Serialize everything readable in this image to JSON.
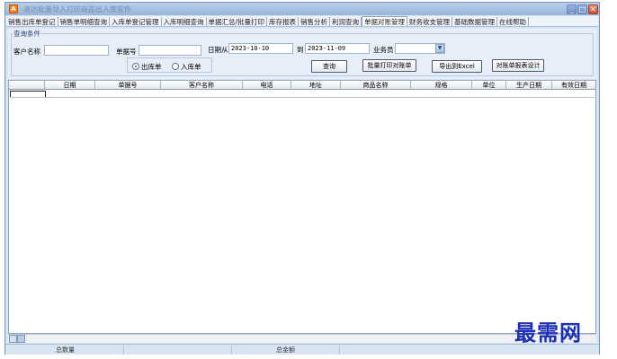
{
  "window": {
    "title": "速达批量导入打印商品出入库软件",
    "app_icon": "A"
  },
  "tabs": [
    {
      "label": "销售出库单登记",
      "active": false
    },
    {
      "label": "销售单明细查询",
      "active": false
    },
    {
      "label": "入库单登记管理",
      "active": false
    },
    {
      "label": "入库明细查询",
      "active": false
    },
    {
      "label": "单据汇总/批量打印",
      "active": false
    },
    {
      "label": "库存报表",
      "active": false
    },
    {
      "label": "销售分析",
      "active": false
    },
    {
      "label": "利润查询",
      "active": false
    },
    {
      "label": "单据对账管理",
      "active": true
    },
    {
      "label": "财务收支管理",
      "active": false
    },
    {
      "label": "基础数据管理",
      "active": false
    },
    {
      "label": "在线帮助",
      "active": false
    }
  ],
  "query": {
    "legend": "查询条件",
    "customer_label": "客户名称",
    "customer_value": "",
    "doc_no_label": "单据号",
    "doc_no_value": "",
    "date_from_label": "日期从",
    "date_from_value": "2023-10-10",
    "date_to_label": "到",
    "date_to_value": "2023-11-09",
    "salesman_label": "业务员",
    "salesman_value": "",
    "radio_out": "出库单",
    "radio_in": "入库单",
    "selected_radio": "出库单"
  },
  "buttons": {
    "search": "查询",
    "batch_print": "批量打印对账单",
    "export_excel": "导出到Excel",
    "report_design": "对账单报表设计"
  },
  "table": {
    "columns": [
      "日期",
      "单据号",
      "客户名称",
      "电话",
      "地址",
      "商品名称",
      "规格",
      "单位",
      "生产日期",
      "有效日期"
    ],
    "rows": []
  },
  "status": {
    "total_qty_label": "总数量",
    "total_amount_label": "总金额"
  },
  "watermark": "最需网",
  "colors": {
    "accent": "#1c2fb5",
    "window_bg": "#d7e4f2",
    "close_red": "#c84f31"
  },
  "icons": {
    "minimize": "minimize-icon",
    "maximize": "maximize-icon",
    "close": "close-icon",
    "dropdown": "chevron-down-icon"
  }
}
